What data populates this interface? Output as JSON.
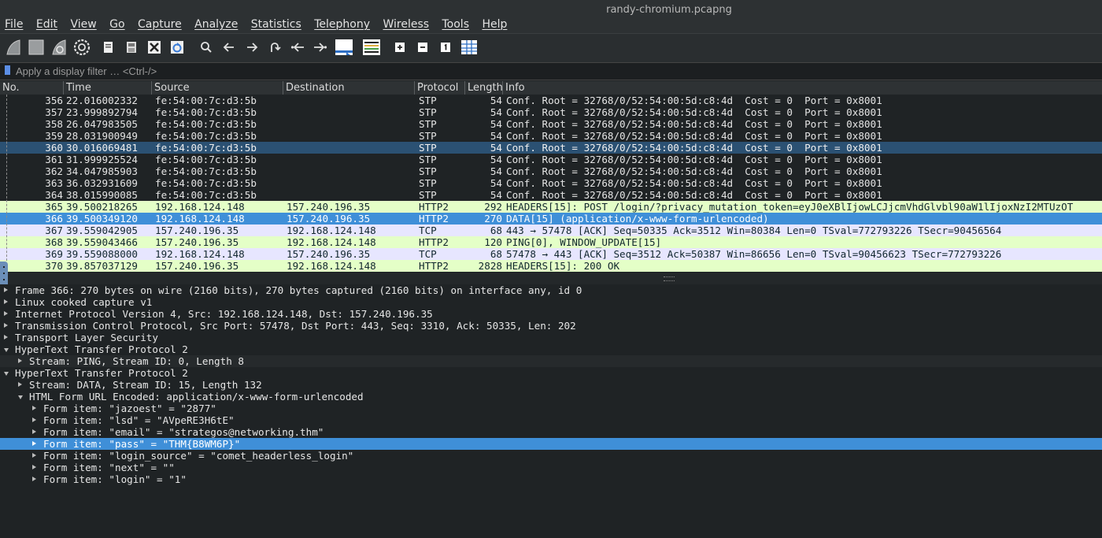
{
  "window": {
    "title": "randy-chromium.pcapng"
  },
  "menu": [
    "File",
    "Edit",
    "View",
    "Go",
    "Capture",
    "Analyze",
    "Statistics",
    "Telephony",
    "Wireless",
    "Tools",
    "Help"
  ],
  "toolbar": {
    "icons": [
      "shark-fin-start-icon",
      "stop-square-icon",
      "restart-fin-icon",
      "gear-options-icon",
      "open-file-icon",
      "save-file-icon",
      "close-file-icon",
      "reload-file-icon",
      "search-icon",
      "back-arrow-icon",
      "forward-arrow-icon",
      "go-to-packet-icon",
      "first-packet-icon",
      "last-packet-icon",
      "autoscroll-icon",
      "colorize-icon",
      "zoom-in-icon",
      "zoom-out-icon",
      "normal-size-icon",
      "resize-columns-icon"
    ]
  },
  "filter": {
    "placeholder": "Apply a display filter … <Ctrl-/>"
  },
  "columns": [
    "No.",
    "Time",
    "Source",
    "Destination",
    "Protocol",
    "Length",
    "Info"
  ],
  "packets": [
    {
      "no": "356",
      "time": "22.016002332",
      "src": "fe:54:00:7c:d3:5b",
      "dst": "",
      "proto": "STP",
      "len": "54",
      "info": "Conf. Root = 32768/0/52:54:00:5d:c8:4d  Cost = 0  Port = 0x8001",
      "style": "stp"
    },
    {
      "no": "357",
      "time": "23.999892794",
      "src": "fe:54:00:7c:d3:5b",
      "dst": "",
      "proto": "STP",
      "len": "54",
      "info": "Conf. Root = 32768/0/52:54:00:5d:c8:4d  Cost = 0  Port = 0x8001",
      "style": "stp"
    },
    {
      "no": "358",
      "time": "26.047983505",
      "src": "fe:54:00:7c:d3:5b",
      "dst": "",
      "proto": "STP",
      "len": "54",
      "info": "Conf. Root = 32768/0/52:54:00:5d:c8:4d  Cost = 0  Port = 0x8001",
      "style": "stp"
    },
    {
      "no": "359",
      "time": "28.031900949",
      "src": "fe:54:00:7c:d3:5b",
      "dst": "",
      "proto": "STP",
      "len": "54",
      "info": "Conf. Root = 32768/0/52:54:00:5d:c8:4d  Cost = 0  Port = 0x8001",
      "style": "stp"
    },
    {
      "no": "360",
      "time": "30.016069481",
      "src": "fe:54:00:7c:d3:5b",
      "dst": "",
      "proto": "STP",
      "len": "54",
      "info": "Conf. Root = 32768/0/52:54:00:5d:c8:4d  Cost = 0  Port = 0x8001",
      "style": "sel-dark"
    },
    {
      "no": "361",
      "time": "31.999925524",
      "src": "fe:54:00:7c:d3:5b",
      "dst": "",
      "proto": "STP",
      "len": "54",
      "info": "Conf. Root = 32768/0/52:54:00:5d:c8:4d  Cost = 0  Port = 0x8001",
      "style": "stp"
    },
    {
      "no": "362",
      "time": "34.047985903",
      "src": "fe:54:00:7c:d3:5b",
      "dst": "",
      "proto": "STP",
      "len": "54",
      "info": "Conf. Root = 32768/0/52:54:00:5d:c8:4d  Cost = 0  Port = 0x8001",
      "style": "stp"
    },
    {
      "no": "363",
      "time": "36.032931609",
      "src": "fe:54:00:7c:d3:5b",
      "dst": "",
      "proto": "STP",
      "len": "54",
      "info": "Conf. Root = 32768/0/52:54:00:5d:c8:4d  Cost = 0  Port = 0x8001",
      "style": "stp"
    },
    {
      "no": "364",
      "time": "38.015990085",
      "src": "fe:54:00:7c:d3:5b",
      "dst": "",
      "proto": "STP",
      "len": "54",
      "info": "Conf. Root = 32768/0/52:54:00:5d:c8:4d  Cost = 0  Port = 0x8001",
      "style": "stp"
    },
    {
      "no": "365",
      "time": "39.500218265",
      "src": "192.168.124.148",
      "dst": "157.240.196.35",
      "proto": "HTTP2",
      "len": "292",
      "info": "HEADERS[15]: POST /login/?privacy_mutation_token=eyJ0eXBlIjowLCJjcmVhdGlvbl90aW1lIjoxNzI2MTUzOT",
      "style": "http2"
    },
    {
      "no": "366",
      "time": "39.500349120",
      "src": "192.168.124.148",
      "dst": "157.240.196.35",
      "proto": "HTTP2",
      "len": "270",
      "info": "DATA[15] (application/x-www-form-urlencoded)",
      "style": "sel-blue"
    },
    {
      "no": "367",
      "time": "39.559042905",
      "src": "157.240.196.35",
      "dst": "192.168.124.148",
      "proto": "TCP",
      "len": "68",
      "info": "443 → 57478 [ACK] Seq=50335 Ack=3512 Win=80384 Len=0 TSval=772793226 TSecr=90456564",
      "style": "tcp"
    },
    {
      "no": "368",
      "time": "39.559043466",
      "src": "157.240.196.35",
      "dst": "192.168.124.148",
      "proto": "HTTP2",
      "len": "120",
      "info": "PING[0], WINDOW_UPDATE[15]",
      "style": "http2"
    },
    {
      "no": "369",
      "time": "39.559088000",
      "src": "192.168.124.148",
      "dst": "157.240.196.35",
      "proto": "TCP",
      "len": "68",
      "info": "57478 → 443 [ACK] Seq=3512 Ack=50387 Win=86656 Len=0 TSval=90456623 TSecr=772793226",
      "style": "tcp"
    },
    {
      "no": "370",
      "time": "39.857037129",
      "src": "157.240.196.35",
      "dst": "192.168.124.148",
      "proto": "HTTP2",
      "len": "2828",
      "info": "HEADERS[15]: 200 OK",
      "style": "http2"
    }
  ],
  "details": [
    {
      "text": "Frame 366: 270 bytes on wire (2160 bits), 270 bytes captured (2160 bits) on interface any, id 0",
      "level": 0,
      "arrow": "right",
      "style": ""
    },
    {
      "text": "Linux cooked capture v1",
      "level": 0,
      "arrow": "right",
      "style": ""
    },
    {
      "text": "Internet Protocol Version 4, Src: 192.168.124.148, Dst: 157.240.196.35",
      "level": 0,
      "arrow": "right",
      "style": ""
    },
    {
      "text": "Transmission Control Protocol, Src Port: 57478, Dst Port: 443, Seq: 3310, Ack: 50335, Len: 202",
      "level": 0,
      "arrow": "right",
      "style": ""
    },
    {
      "text": "Transport Layer Security",
      "level": 0,
      "arrow": "right",
      "style": ""
    },
    {
      "text": "HyperText Transfer Protocol 2",
      "level": 0,
      "arrow": "down",
      "style": ""
    },
    {
      "text": "Stream: PING, Stream ID: 0, Length 8",
      "level": 1,
      "arrow": "right",
      "style": "alt"
    },
    {
      "text": "HyperText Transfer Protocol 2",
      "level": 0,
      "arrow": "down",
      "style": ""
    },
    {
      "text": "Stream: DATA, Stream ID: 15, Length 132",
      "level": 1,
      "arrow": "right",
      "style": ""
    },
    {
      "text": "HTML Form URL Encoded: application/x-www-form-urlencoded",
      "level": 1,
      "arrow": "down",
      "style": ""
    },
    {
      "text": "Form item: \"jazoest\" = \"2877\"",
      "level": 2,
      "arrow": "right",
      "style": ""
    },
    {
      "text": "Form item: \"lsd\" = \"AVpeRE3H6tE\"",
      "level": 2,
      "arrow": "right",
      "style": ""
    },
    {
      "text": "Form item: \"email\" = \"strategos@networking.thm\"",
      "level": 2,
      "arrow": "right",
      "style": ""
    },
    {
      "text": "Form item: \"pass\" = \"THM{B8WM6P}\"",
      "level": 2,
      "arrow": "right",
      "style": "sel"
    },
    {
      "text": "Form item: \"login_source\" = \"comet_headerless_login\"",
      "level": 2,
      "arrow": "right",
      "style": ""
    },
    {
      "text": "Form item: \"next\" = \"\"",
      "level": 2,
      "arrow": "right",
      "style": ""
    },
    {
      "text": "Form item: \"login\" = \"1\"",
      "level": 2,
      "arrow": "right",
      "style": ""
    }
  ]
}
